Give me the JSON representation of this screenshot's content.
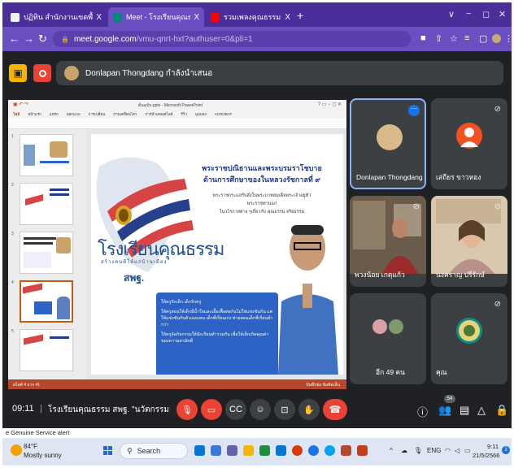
{
  "browser": {
    "tabs": [
      {
        "title": "ปฏิทิน สำนักงานเขตพื้นที่การศึกษาประ",
        "favicon_color": "#f0f0f0",
        "active": false
      },
      {
        "title": "Meet - โรงเรียนคุณธรรม สพฐ.",
        "favicon_color": "#00897b",
        "active": true
      },
      {
        "title": "รวมเพลงคุณธรรม - YouTube",
        "favicon_color": "#ff0000",
        "active": false
      }
    ],
    "tab_close": "X",
    "new_tab": "+",
    "window_controls": [
      "∨",
      "−",
      "◻",
      "✕"
    ],
    "url_host": "meet.google.com",
    "url_path": "/vmu-qnrt-hxt?authuser=0&pli=1"
  },
  "presenter": {
    "text": "Donlapan Thongdang กำลังนำเสนอ"
  },
  "powerpoint": {
    "window_caption": "ต้นฉบับ.pptx - Microsoft PowerPoint",
    "menu": [
      "ไฟล์",
      "หน้าแรก",
      "แทรก",
      "ออกแบบ",
      "การเปลี่ยน",
      "ภาพเคลื่อนไหว",
      "การนำเสนอสไลด์",
      "รีวิว",
      "มุมมอง",
      "ACROBAT"
    ],
    "slide_numbers": [
      "1",
      "2",
      "3",
      "4",
      "5"
    ],
    "status_left": "สไลด์ 4 จาก 41",
    "status_right": "บันทึกย่อ   ข้อคิดเห็น",
    "slide": {
      "title_line1": "พระราชปณิธานและพระบรมราโชบาย",
      "title_line2": "ด้านการศึกษาของในหลวงรัชกาลที่ ๙",
      "sub_line1": "พระราชกระแสรับสั่งในพระบาทสมเด็จพระเจ้าอยู่หัว",
      "sub_line2": "พระราชทานแก่",
      "sub_line3": "ในวโรกาสต่าง ๆเกี่ยวกับ คุณธรรม จริยธรรม",
      "school_name": "โรงเรียนคุณธรรม",
      "school_sub": "สร้างคนดีให้แก่บ้านเมือง",
      "school_abbr": "สพฐ.",
      "bullets": [
        "ให้ครูรักเด็ก เด็กรักครู",
        "ให้ครูสอนให้เด็กมีน้ำใจและเอื้อเฟื้อต่อกันไม่ใช่แข่งขันกัน แต่ให้แข่งขันกับตัวเองแทน เด็กที่เรียนเก่ง ช่วยสอนเด็กที่เรียนช้ากว่า",
        "ให้ครูจัดกิจกรรมให้นักเรียนทำร่วมกัน เพื่อให้เด็กเกิดคุณค่าของความสามัคคี"
      ]
    }
  },
  "participants": [
    {
      "name": "Donlapan Thongdang",
      "kind": "avatar",
      "active": true
    },
    {
      "name": "เสถียร ขาวหอง",
      "kind": "letter"
    },
    {
      "name": "พวงน้อย เกตุแก้ว",
      "kind": "video"
    },
    {
      "name": "นงคราญ ปรีรักษ์",
      "kind": "video"
    },
    {
      "name": "อีก 49 คน",
      "kind": "others"
    },
    {
      "name": "คุณ",
      "kind": "self"
    }
  ],
  "meet_controls": {
    "clock": "09:11",
    "separator": "|",
    "meeting_name": "โรงเรียนคุณธรรม สพฐ. \"นวัตกรรมสร้างสรรค์คน...",
    "people_badge": "54",
    "icons": [
      "mic-off",
      "camera-off",
      "captions",
      "emoji",
      "present",
      "raise-hand",
      "more",
      "leave-call"
    ],
    "right_icons": [
      "info",
      "people",
      "chat",
      "activities",
      "host-controls"
    ]
  },
  "notification": "e Genuine Service alert",
  "taskbar": {
    "temp": "84°F",
    "condition": "Mostly sunny",
    "search": "Search",
    "tray": "ENG",
    "time": "9:11",
    "date": "21/5/2566",
    "notification_count": "2",
    "app_colors": [
      "#0078d4",
      "#3c78d8",
      "#6264a7",
      "#f2b705",
      "#1e8e3e",
      "#0078d4",
      "#d83b01",
      "#1a73e8",
      "#00a4ef",
      "#b7472a",
      "#c43e1c"
    ]
  }
}
